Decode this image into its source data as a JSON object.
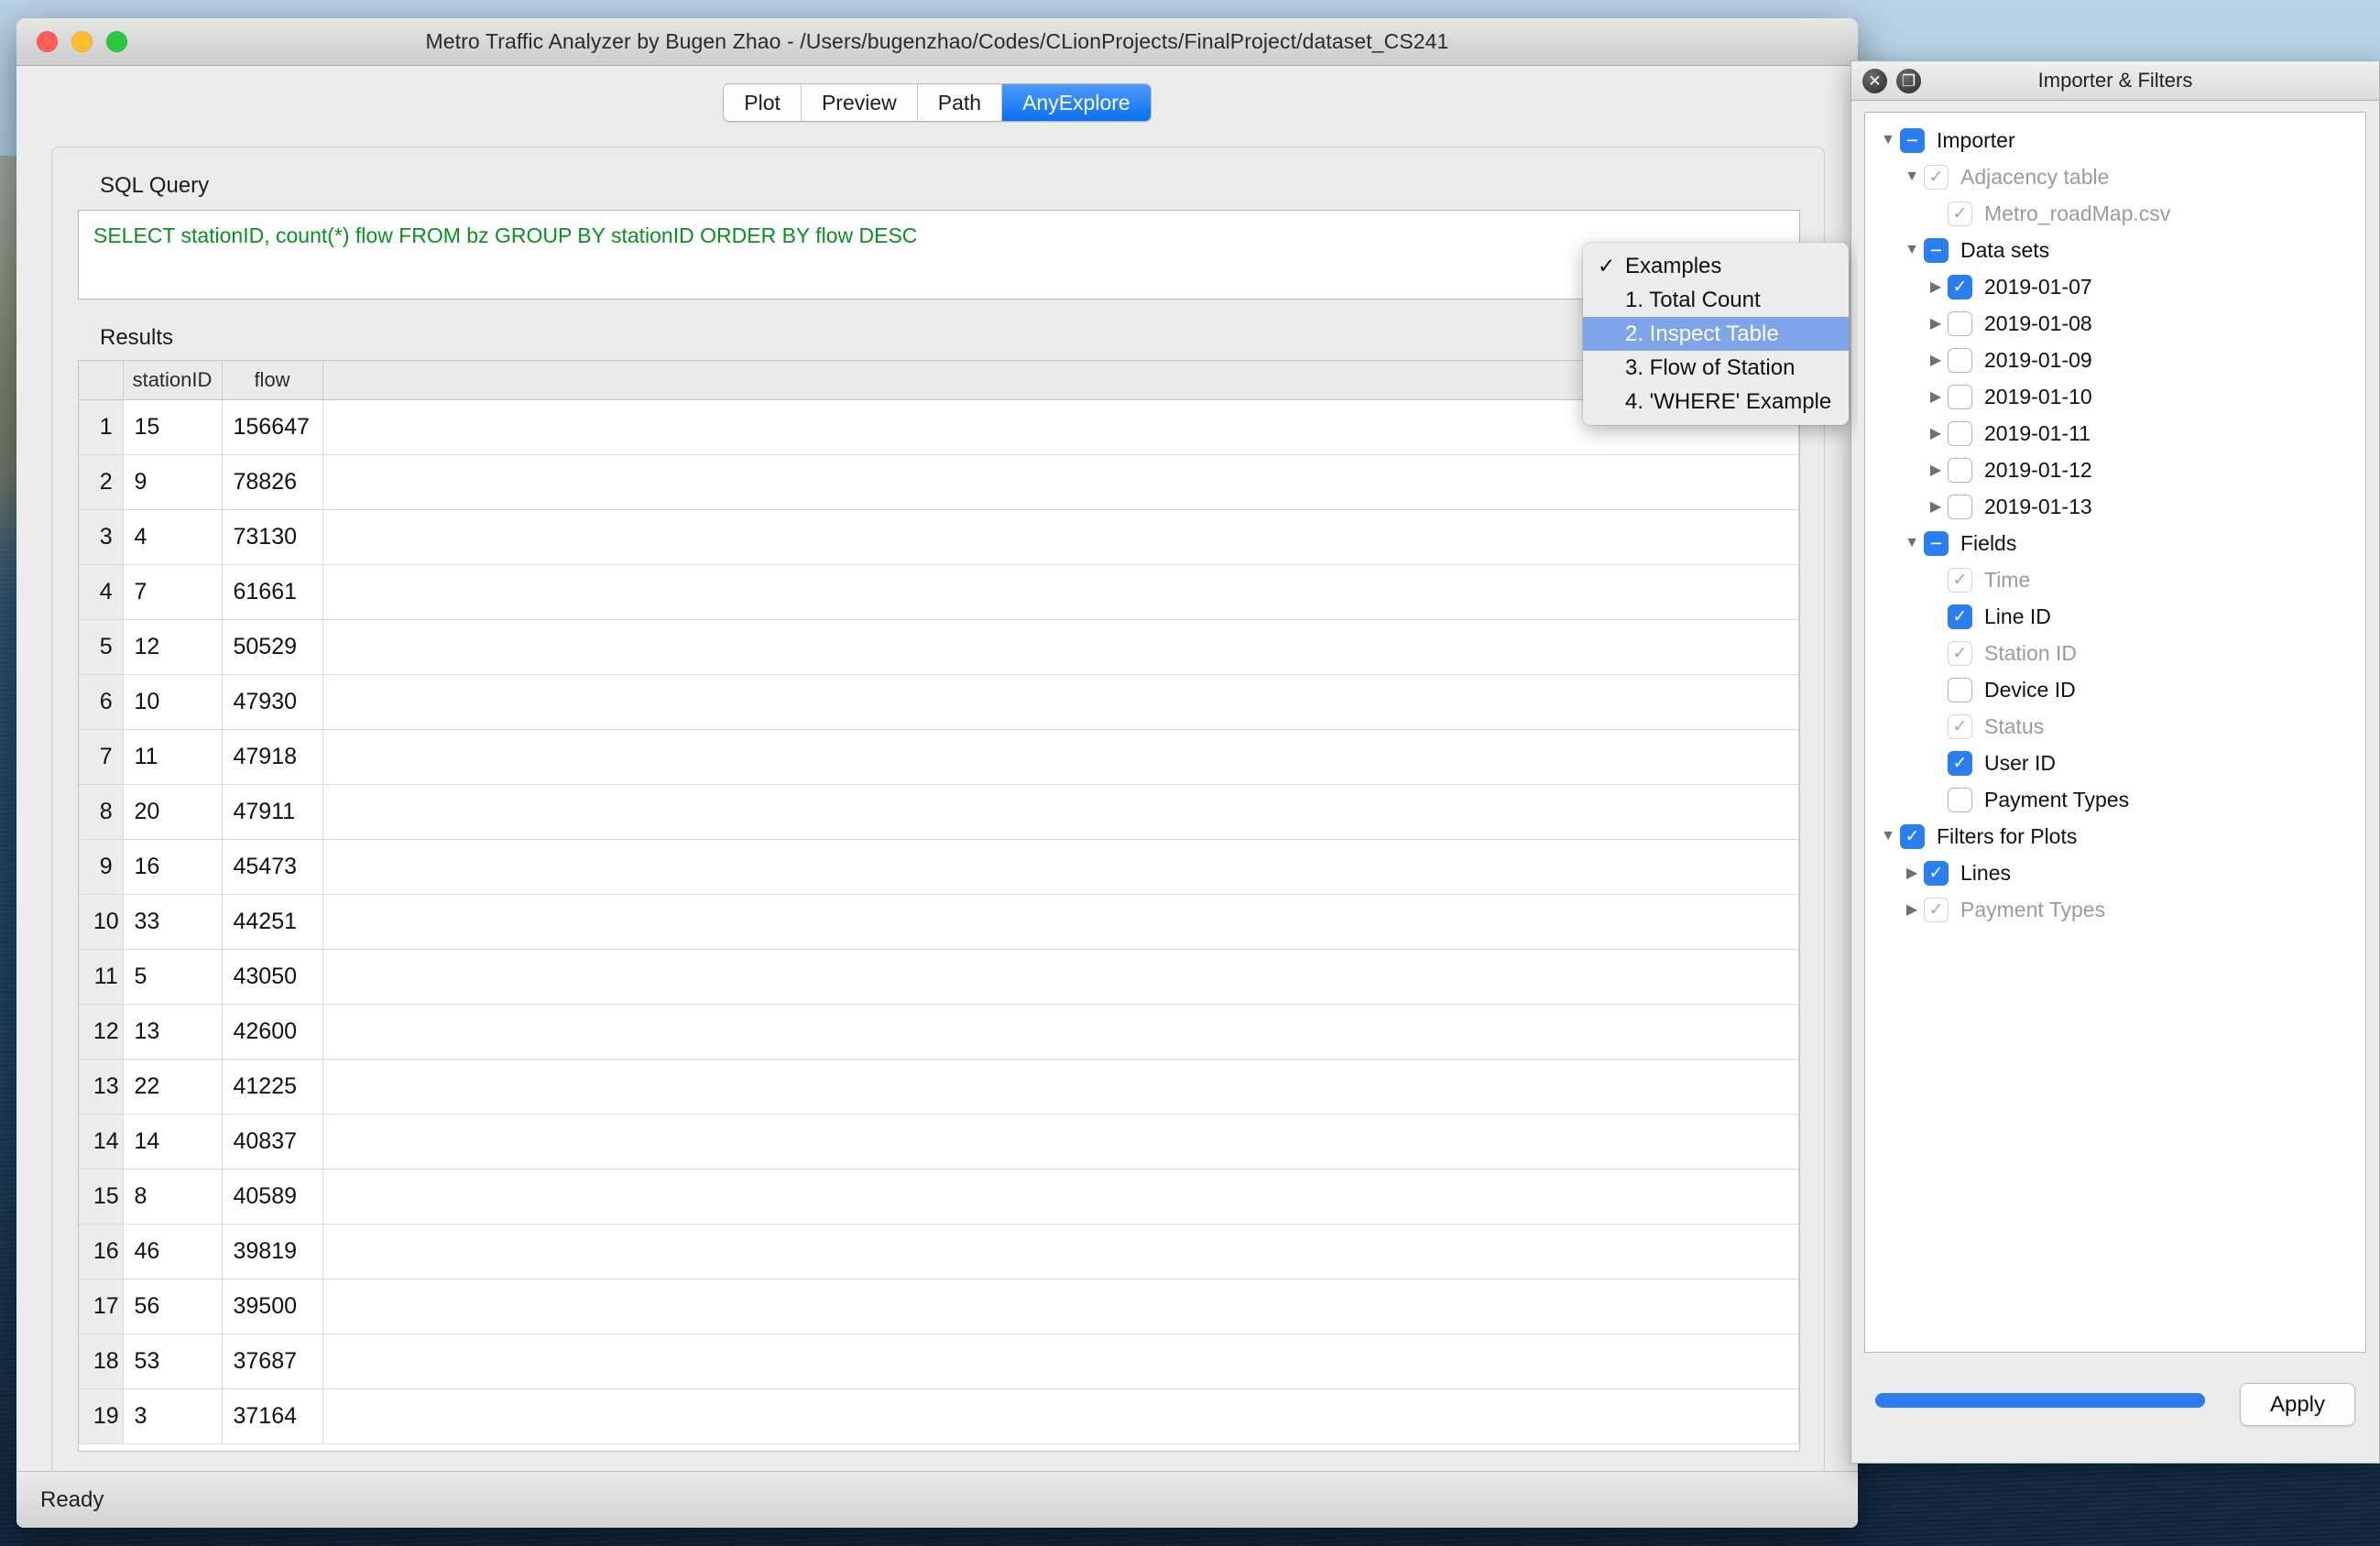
{
  "window": {
    "title": "Metro Traffic Analyzer by Bugen Zhao - /Users/bugenzhao/Codes/CLionProjects/FinalProject/dataset_CS241",
    "close_icon": "close-icon",
    "minimize_icon": "minimize-icon",
    "zoom_icon": "zoom-icon"
  },
  "tabs": [
    {
      "label": "Plot",
      "active": false
    },
    {
      "label": "Preview",
      "active": false
    },
    {
      "label": "Path",
      "active": false
    },
    {
      "label": "AnyExplore",
      "active": true
    }
  ],
  "sql": {
    "label": "SQL Query",
    "value": "SELECT stationID, count(*) flow FROM bz GROUP BY stationID ORDER BY flow DESC",
    "text_color": "#0a8f22"
  },
  "results": {
    "label": "Results",
    "columns": [
      "",
      "stationID",
      "flow",
      ""
    ],
    "rows": [
      {
        "n": "1",
        "stationID": "15",
        "flow": "156647"
      },
      {
        "n": "2",
        "stationID": "9",
        "flow": "78826"
      },
      {
        "n": "3",
        "stationID": "4",
        "flow": "73130"
      },
      {
        "n": "4",
        "stationID": "7",
        "flow": "61661"
      },
      {
        "n": "5",
        "stationID": "12",
        "flow": "50529"
      },
      {
        "n": "6",
        "stationID": "10",
        "flow": "47930"
      },
      {
        "n": "7",
        "stationID": "11",
        "flow": "47918"
      },
      {
        "n": "8",
        "stationID": "20",
        "flow": "47911"
      },
      {
        "n": "9",
        "stationID": "16",
        "flow": "45473"
      },
      {
        "n": "10",
        "stationID": "33",
        "flow": "44251"
      },
      {
        "n": "11",
        "stationID": "5",
        "flow": "43050"
      },
      {
        "n": "12",
        "stationID": "13",
        "flow": "42600"
      },
      {
        "n": "13",
        "stationID": "22",
        "flow": "41225"
      },
      {
        "n": "14",
        "stationID": "14",
        "flow": "40837"
      },
      {
        "n": "15",
        "stationID": "8",
        "flow": "40589"
      },
      {
        "n": "16",
        "stationID": "46",
        "flow": "39819"
      },
      {
        "n": "17",
        "stationID": "56",
        "flow": "39500"
      },
      {
        "n": "18",
        "stationID": "53",
        "flow": "37687"
      },
      {
        "n": "19",
        "stationID": "3",
        "flow": "37164"
      }
    ]
  },
  "menu": {
    "items": [
      {
        "label": "Examples",
        "checked": true,
        "selected": false
      },
      {
        "label": "1. Total Count",
        "checked": false,
        "selected": false
      },
      {
        "label": "2. Inspect Table",
        "checked": false,
        "selected": true
      },
      {
        "label": "3. Flow of Station",
        "checked": false,
        "selected": false
      },
      {
        "label": "4. 'WHERE' Example",
        "checked": false,
        "selected": false
      }
    ],
    "check_glyph": "✓",
    "highlight_color": "#7da5e8"
  },
  "statusbar": {
    "text": "Ready"
  },
  "dock": {
    "title": "Importer & Filters",
    "close_icon": "✕",
    "float_icon": "❐",
    "tree": [
      {
        "label": "Importer",
        "indent": 0,
        "arrow": "down",
        "state": "tri",
        "dim": false
      },
      {
        "label": "Adjacency table",
        "indent": 1,
        "arrow": "down",
        "state": "gray",
        "dim": true
      },
      {
        "label": "Metro_roadMap.csv",
        "indent": 2,
        "arrow": "none",
        "state": "gray",
        "dim": true
      },
      {
        "label": "Data sets",
        "indent": 1,
        "arrow": "down",
        "state": "tri",
        "dim": false
      },
      {
        "label": "2019-01-07",
        "indent": 2,
        "arrow": "right",
        "state": "checked",
        "dim": false
      },
      {
        "label": "2019-01-08",
        "indent": 2,
        "arrow": "right",
        "state": "unchecked",
        "dim": false
      },
      {
        "label": "2019-01-09",
        "indent": 2,
        "arrow": "right",
        "state": "unchecked",
        "dim": false
      },
      {
        "label": "2019-01-10",
        "indent": 2,
        "arrow": "right",
        "state": "unchecked",
        "dim": false
      },
      {
        "label": "2019-01-11",
        "indent": 2,
        "arrow": "right",
        "state": "unchecked",
        "dim": false
      },
      {
        "label": "2019-01-12",
        "indent": 2,
        "arrow": "right",
        "state": "unchecked",
        "dim": false
      },
      {
        "label": "2019-01-13",
        "indent": 2,
        "arrow": "right",
        "state": "unchecked",
        "dim": false
      },
      {
        "label": "Fields",
        "indent": 1,
        "arrow": "down",
        "state": "tri",
        "dim": false
      },
      {
        "label": "Time",
        "indent": 2,
        "arrow": "none",
        "state": "gray",
        "dim": true
      },
      {
        "label": "Line ID",
        "indent": 2,
        "arrow": "none",
        "state": "checked",
        "dim": false
      },
      {
        "label": "Station ID",
        "indent": 2,
        "arrow": "none",
        "state": "gray",
        "dim": true
      },
      {
        "label": "Device ID",
        "indent": 2,
        "arrow": "none",
        "state": "unchecked",
        "dim": false
      },
      {
        "label": "Status",
        "indent": 2,
        "arrow": "none",
        "state": "gray",
        "dim": true
      },
      {
        "label": "User ID",
        "indent": 2,
        "arrow": "none",
        "state": "checked",
        "dim": false
      },
      {
        "label": "Payment Types",
        "indent": 2,
        "arrow": "none",
        "state": "unchecked",
        "dim": false
      },
      {
        "label": "Filters for Plots",
        "indent": 0,
        "arrow": "down",
        "state": "checked",
        "dim": false
      },
      {
        "label": "Lines",
        "indent": 1,
        "arrow": "right",
        "state": "checked",
        "dim": false
      },
      {
        "label": "Payment Types",
        "indent": 1,
        "arrow": "right",
        "state": "gray",
        "dim": true
      }
    ],
    "progress_percent": 100,
    "progress_color": "#2a7ef0",
    "apply_label": "Apply"
  }
}
